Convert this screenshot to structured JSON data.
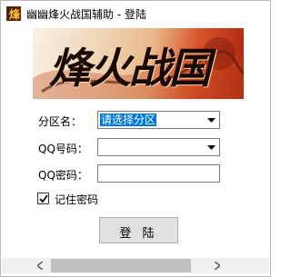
{
  "window": {
    "title": "幽幽烽火战国辅助 - 登陆",
    "icon_char": "烽",
    "icon": "app-logo-icon"
  },
  "banner": {
    "logo_text": "烽火战国",
    "accent": "#a9240f"
  },
  "form": {
    "zone_label": "分区名：",
    "zone_value": "请选择分区",
    "qq_label": "QQ号码：",
    "qq_value": "",
    "password_label": "QQ密码：",
    "password_value": "",
    "remember_label": "记住密码",
    "remember_checked": true,
    "login_button": "登 陆"
  },
  "colors": {
    "selection": "#0078d7",
    "button_bg": "#e1e1e1"
  }
}
